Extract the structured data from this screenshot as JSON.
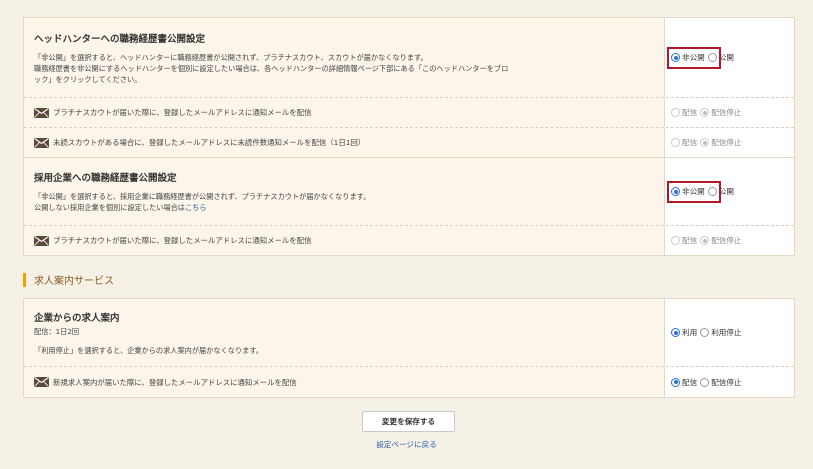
{
  "headhunter": {
    "title": "ヘッドハンターへの職務経歴書公開設定",
    "desc1": "「非公開」を選択すると、ヘッドハンターに職務経歴書が公開されず、プラチナスカウト、スカウトが届かなくなります。",
    "desc2": "職務経歴書を非公開にするヘッドハンターを個別に設定したい場合は、各ヘッドハンターの詳細情報ページ下部にある「このヘッドハンターをブロ",
    "desc3": "ック」をクリックしてください。",
    "opt_private": "非公開",
    "opt_public": "公開",
    "mail1": "プラチナスカウトが届いた際に、登録したメールアドレスに通知メールを配信",
    "mail2": "未読スカウトがある場合に、登録したメールアドレスに未読件数通知メールを配信（1日1回）"
  },
  "company": {
    "title": "採用企業への職務経歴書公開設定",
    "desc1": "「非公開」を選択すると、採用企業に職務経歴書が公開されず、プラチナスカウトが届かなくなります。",
    "desc2": "公開しない採用企業を個別に設定したい場合は",
    "desc2_link": "こちら",
    "opt_private": "非公開",
    "opt_public": "公開",
    "mail1": "プラチナスカウトが届いた際に、登録したメールアドレスに通知メールを配信"
  },
  "mail_options": {
    "deliver": "配信",
    "stop": "配信停止"
  },
  "job_service": {
    "heading": "求人案内サービス",
    "title": "企業からの求人案内",
    "freq": "配信：1日2回",
    "desc": "「利用停止」を選択すると、企業からの求人案内が届かなくなります。",
    "opt_use": "利用",
    "opt_stop": "利用停止",
    "mail1": "新規求人案内が届いた際に、登録したメールアドレスに通知メールを配信"
  },
  "footer": {
    "save_label": "変更を保存する",
    "back_label": "設定ページに戻る"
  },
  "colors": {
    "accent_bar": "#e8a500",
    "highlight_box": "#b0182a",
    "radio_selected": "#2a6fd6",
    "link": "#2d5ea7",
    "mail_icon": "#5b4a3a"
  }
}
